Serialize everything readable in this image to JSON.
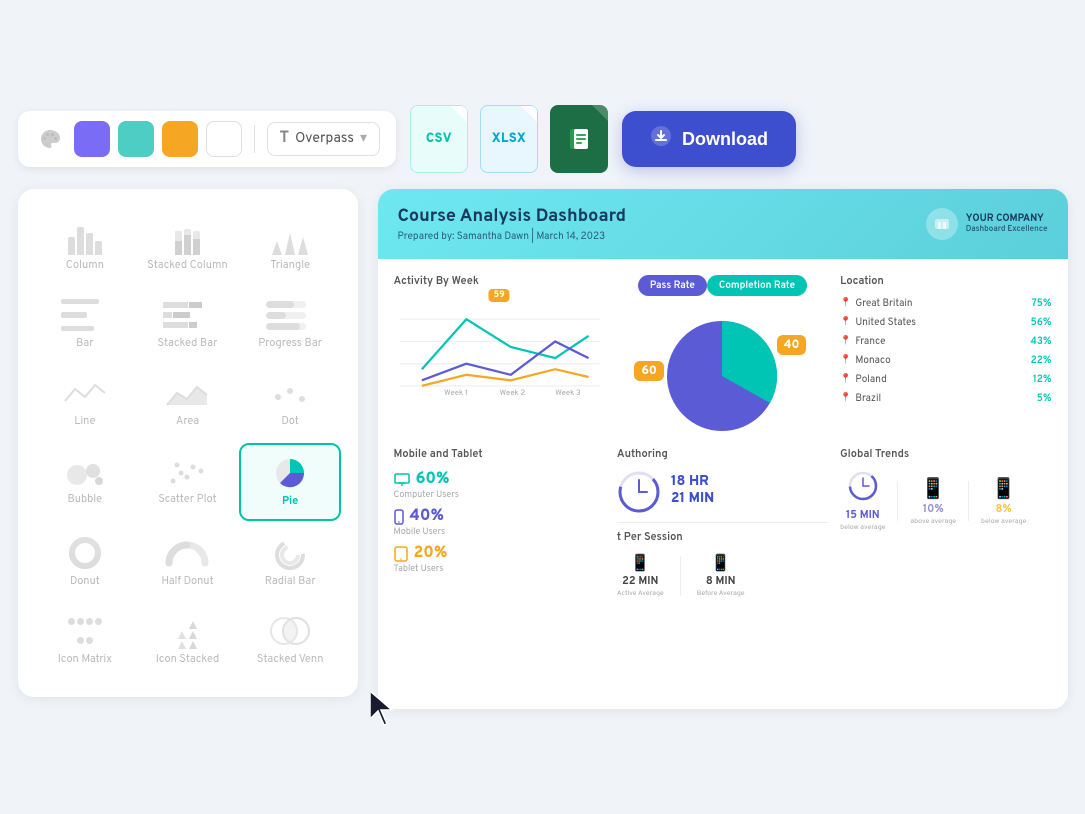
{
  "toolbar": {
    "paint_icon": "🪣",
    "colors": [
      "#7B6CF6",
      "#4ECDC4",
      "#F5A623",
      "#FFFFFF"
    ],
    "font_label": "Overpass",
    "font_icon": "T",
    "chevron": "▾",
    "export_csv": "CSV",
    "export_xlsx": "XLSX",
    "export_sheets": "⊞",
    "download_label": "Download",
    "download_icon": "⬇"
  },
  "chart_types": [
    {
      "id": "column",
      "label": "Column"
    },
    {
      "id": "stacked-column",
      "label": "Stacked Column"
    },
    {
      "id": "triangle",
      "label": "Triangle"
    },
    {
      "id": "bar",
      "label": "Bar"
    },
    {
      "id": "stacked-bar",
      "label": "Stacked Bar"
    },
    {
      "id": "progress-bar",
      "label": "Progress Bar"
    },
    {
      "id": "line",
      "label": "Line"
    },
    {
      "id": "area",
      "label": "Area"
    },
    {
      "id": "dot",
      "label": "Dot"
    },
    {
      "id": "bubble",
      "label": "Bubble"
    },
    {
      "id": "scatter-plot",
      "label": "Scatter Plot"
    },
    {
      "id": "pie",
      "label": "Pie",
      "active": true
    },
    {
      "id": "donut",
      "label": "Donut"
    },
    {
      "id": "half-donut",
      "label": "Half Donut"
    },
    {
      "id": "radial-bar",
      "label": "Radial Bar"
    },
    {
      "id": "icon-matrix",
      "label": "Icon Matrix"
    },
    {
      "id": "icon-stacked",
      "label": "Icon Stacked"
    },
    {
      "id": "stacked-venn",
      "label": "Stacked Venn"
    }
  ],
  "dashboard": {
    "title": "Course Analysis Dashboard",
    "subtitle": "Prepared by: Samantha Dawn | March 14, 2023",
    "company_name": "YOUR COMPANY",
    "company_tagline": "Dashboard Excellence",
    "sections": {
      "activity": {
        "title": "Activity By Week",
        "peak_label": "59",
        "week_labels": [
          "Week 1",
          "Week 2",
          "Week 3"
        ]
      },
      "passrate": {
        "tab1": "Pass Rate",
        "tab2": "Completion Rate",
        "value1": 60,
        "value2": 40,
        "label1": "60",
        "label2": "40"
      },
      "location": {
        "title": "Location",
        "items": [
          {
            "name": "Great Britain",
            "pct": "75%"
          },
          {
            "name": "United States",
            "pct": "56%"
          },
          {
            "name": "France",
            "pct": "43%"
          },
          {
            "name": "Monaco",
            "pct": "22%"
          },
          {
            "name": "Poland",
            "pct": "12%"
          },
          {
            "name": "Brazil",
            "pct": "5%"
          }
        ]
      },
      "mobile": {
        "title": "Mobile and Tablet",
        "items": [
          {
            "value": "60%",
            "label": "Computer Users",
            "color": "#00c4b4"
          },
          {
            "value": "40%",
            "label": "Mobile Users",
            "color": "#5b5bd6"
          },
          {
            "value": "20%",
            "label": "Tablet Users",
            "color": "#f5a623"
          }
        ]
      },
      "authoring": {
        "title": "Authoring",
        "value": "18 HR",
        "value2": "21 MIN",
        "icon_color": "#5b5bd6"
      },
      "per_session": {
        "title": "t Per Session",
        "stats": [
          {
            "value": "22 MIN",
            "label": "Active Average",
            "icon": "📱",
            "color": "#9b8fd4"
          },
          {
            "value": "8 MIN",
            "label": "Before Average",
            "icon": "📱",
            "color": "#f5c842"
          }
        ]
      },
      "global_trends": {
        "title": "Global Trends",
        "stats": [
          {
            "value": "15 MIN",
            "label": "below average",
            "icon": "🕐",
            "color": "#5b5bd6"
          },
          {
            "value": "10%",
            "label": "above average",
            "icon": "📱",
            "color": "#9b8fd4"
          },
          {
            "value": "8%",
            "label": "below average",
            "icon": "📱",
            "color": "#f5c842"
          }
        ]
      }
    }
  }
}
